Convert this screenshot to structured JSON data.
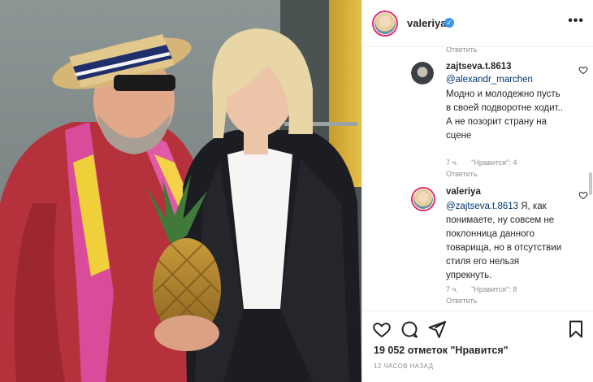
{
  "post": {
    "username": "valeriya",
    "verified_icon": "✓",
    "more_icon": "•••"
  },
  "comments": {
    "reply_label_top": "Ответить",
    "items": [
      {
        "username": "zajtseva.t.8613",
        "mention": "@alexandr_marchen",
        "text": "Модно и молодежно пусть в своей подворотне ходит.. А не позорит страну на сцене",
        "time": "7 ч.",
        "likes": "\"Нравится\": 4",
        "reply": "Ответить"
      },
      {
        "username": "valeriya",
        "mention": "@zajtseva.t.8613",
        "text": "Я, как понимаете, ну совсем не поклонница данного товарища, но в отсутствии стиля его нельзя упрекнуть.",
        "time": "7 ч.",
        "likes": "\"Нравится\": 8",
        "reply": "Ответить"
      }
    ]
  },
  "footer": {
    "likes_count": "19 052 отметок \"Нравится\"",
    "timestamp": "12 ЧАСОВ НАЗАД"
  },
  "colors": {
    "story_ring": "#e1306c",
    "verified": "#3897f0",
    "mention": "#00376b",
    "secondary_text": "#8e8e8e"
  },
  "icons": [
    "heart-icon",
    "comment-icon",
    "share-icon",
    "bookmark-icon",
    "more-options-icon",
    "verified-badge-icon"
  ]
}
